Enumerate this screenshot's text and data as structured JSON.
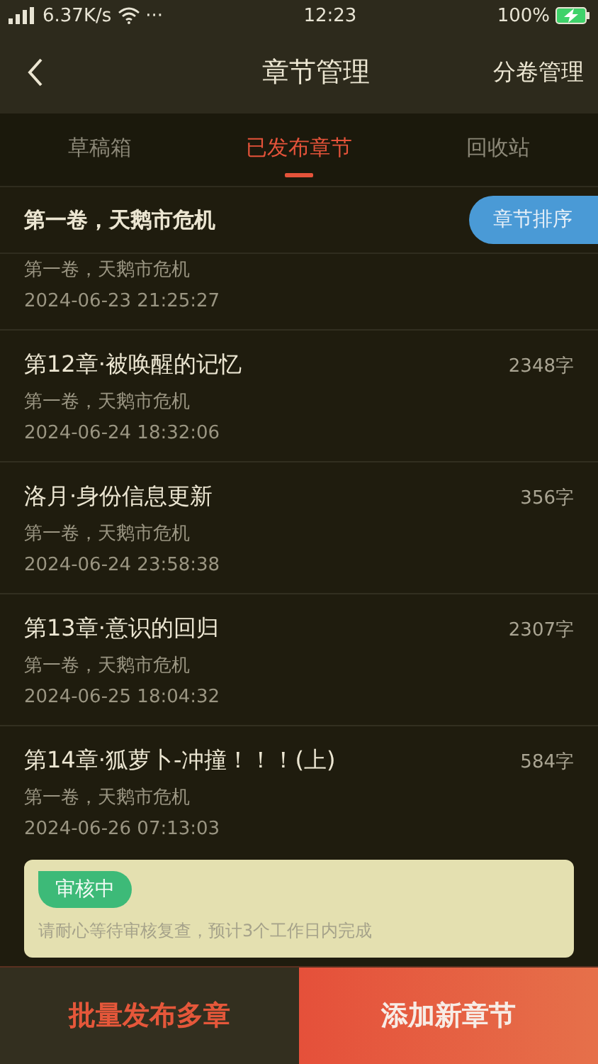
{
  "status_bar": {
    "speed": "6.37K/s",
    "more": "···",
    "time": "12:23",
    "battery": "100%",
    "charging": true
  },
  "nav": {
    "title": "章节管理",
    "action": "分卷管理"
  },
  "tabs": [
    {
      "label": "草稿箱",
      "selected": false
    },
    {
      "label": "已发布章节",
      "selected": true
    },
    {
      "label": "回收站",
      "selected": false
    }
  ],
  "section": {
    "volume": "第一卷，天鹅市危机",
    "sort_button": "章节排序"
  },
  "chapters": [
    {
      "volume": "第一卷，天鹅市危机",
      "date": "2024-06-23 21:25:27"
    },
    {
      "title": "第12章·被唤醒的记忆",
      "words": "2348字",
      "volume": "第一卷，天鹅市危机",
      "date": "2024-06-24 18:32:06"
    },
    {
      "title": "洛月·身份信息更新",
      "words": "356字",
      "volume": "第一卷，天鹅市危机",
      "date": "2024-06-24 23:58:38"
    },
    {
      "title": "第13章·意识的回归",
      "words": "2307字",
      "volume": "第一卷，天鹅市危机",
      "date": "2024-06-25 18:04:32"
    },
    {
      "title": "第14章·狐萝卜-冲撞！！！(上)",
      "words": "584字",
      "volume": "第一卷，天鹅市危机",
      "date": "2024-06-26 07:13:03",
      "review": {
        "status": "审核中",
        "note": "请耐心等待审核复查，预计3个工作日内完成"
      }
    }
  ],
  "bottom_buttons": [
    {
      "label": "批量发布多章",
      "kind": "secondary"
    },
    {
      "label": "添加新章节",
      "kind": "primary"
    }
  ]
}
